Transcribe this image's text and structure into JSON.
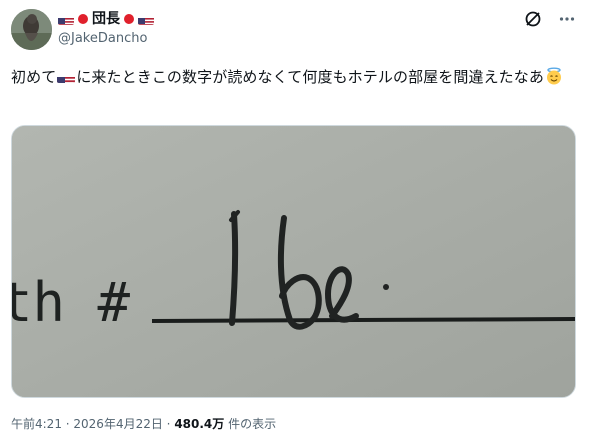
{
  "post": {
    "author_name": "団長",
    "handle": "@JakeDancho",
    "text_part1": "初めて",
    "text_part2": "に来たときこの数字が読めなくて何度もホテルの部屋を間違えたなあ",
    "flag_emoji_name": "us-flag-icon",
    "end_emoji_name": "smiling-face-with-halo-icon",
    "image_text_label": "th #",
    "image_handwriting": "16."
  },
  "meta": {
    "time": "午前4:21",
    "sep1": " · ",
    "date": "2026年4月22日",
    "sep2": " · ",
    "views": "480.4万",
    "views_suffix": " 件の表示"
  },
  "colors": {
    "secondary_text": "#536471",
    "primary_text": "#0f1419",
    "border": "#cfd9de"
  }
}
